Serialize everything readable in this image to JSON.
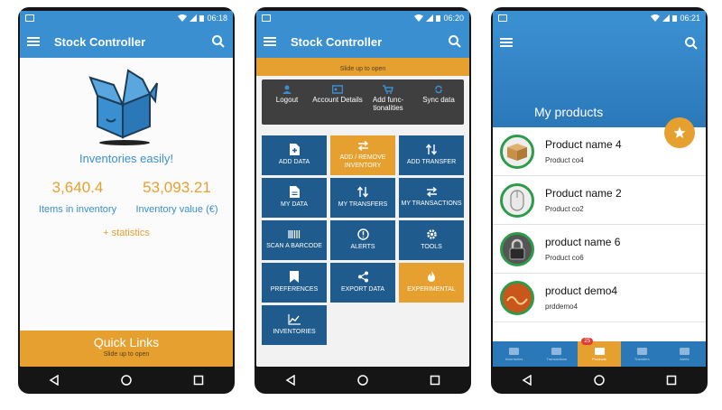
{
  "phone1": {
    "status_time": "06:18",
    "app_title": "Stock Controller",
    "tagline": "Inventories easily!",
    "items_value": "3,640.4",
    "items_label": "Items in inventory",
    "inventory_value": "53,093.21",
    "inventory_label": "Inventory value (€)",
    "statistics_link": "+ statistics",
    "quick_links_title": "Quick Links",
    "quick_links_hint": "Slide up to open"
  },
  "phone2": {
    "status_time": "06:20",
    "app_title": "Stock Controller",
    "slide_hint": "Slide up to open",
    "menu": [
      {
        "label": "Logout",
        "icon": "user-icon"
      },
      {
        "label": "Account Details",
        "icon": "account-card-icon"
      },
      {
        "label": "Add func-tionalities",
        "icon": "cart-icon"
      },
      {
        "label": "Sync data",
        "icon": "sync-icon"
      }
    ],
    "tiles": [
      {
        "label": "Add data",
        "icon": "add-file-icon",
        "color": "blue"
      },
      {
        "label": "Add / Remove inventory",
        "icon": "swap-icon",
        "color": "orange"
      },
      {
        "label": "Add transfer",
        "icon": "updown-icon",
        "color": "blue"
      },
      {
        "label": "My data",
        "icon": "file-icon",
        "color": "blue"
      },
      {
        "label": "My transfers",
        "icon": "updown-icon",
        "color": "blue"
      },
      {
        "label": "My transactions",
        "icon": "swap-icon",
        "color": "blue"
      },
      {
        "label": "Scan a barcode",
        "icon": "barcode-icon",
        "color": "blue"
      },
      {
        "label": "Alerts",
        "icon": "alert-icon",
        "color": "blue"
      },
      {
        "label": "Tools",
        "icon": "gear-icon",
        "color": "blue"
      },
      {
        "label": "Preferences",
        "icon": "bookmark-icon",
        "color": "blue"
      },
      {
        "label": "Export data",
        "icon": "share-icon",
        "color": "blue"
      },
      {
        "label": "Experimental",
        "icon": "flame-icon",
        "color": "orange"
      },
      {
        "label": "Inventories",
        "icon": "chart-icon",
        "color": "blue"
      }
    ]
  },
  "phone3": {
    "status_time": "06:21",
    "title": "My products",
    "products": [
      {
        "name": "Product name 4",
        "code": "Product co4"
      },
      {
        "name": "Product name 2",
        "code": "Product co2"
      },
      {
        "name": "product name 6",
        "code": "Product co6"
      },
      {
        "name": "product demo4",
        "code": "prddemo4"
      }
    ],
    "bottom_nav": [
      "Inventories",
      "Transactions",
      "Products",
      "Transfers",
      "Alerts"
    ],
    "badge_count": "25"
  },
  "colors": {
    "primary": "#3a8fd1",
    "accent": "#e6a02f",
    "tile_blue": "#1f5c8d"
  }
}
